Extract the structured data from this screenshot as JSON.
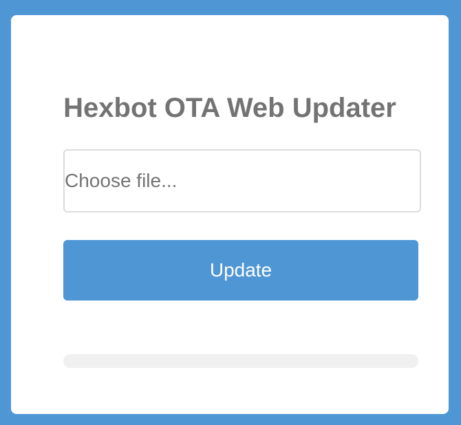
{
  "page": {
    "title": "Hexbot OTA Web Updater"
  },
  "file_input": {
    "placeholder": "Choose file..."
  },
  "update_button": {
    "label": "Update"
  },
  "progress": {
    "value_percent": 0
  },
  "colors": {
    "accent": "#4f96d5",
    "card_background": "#ffffff",
    "text": "#737373",
    "progress_track": "#f0f0f0",
    "field_border": "#dcdcdc"
  }
}
